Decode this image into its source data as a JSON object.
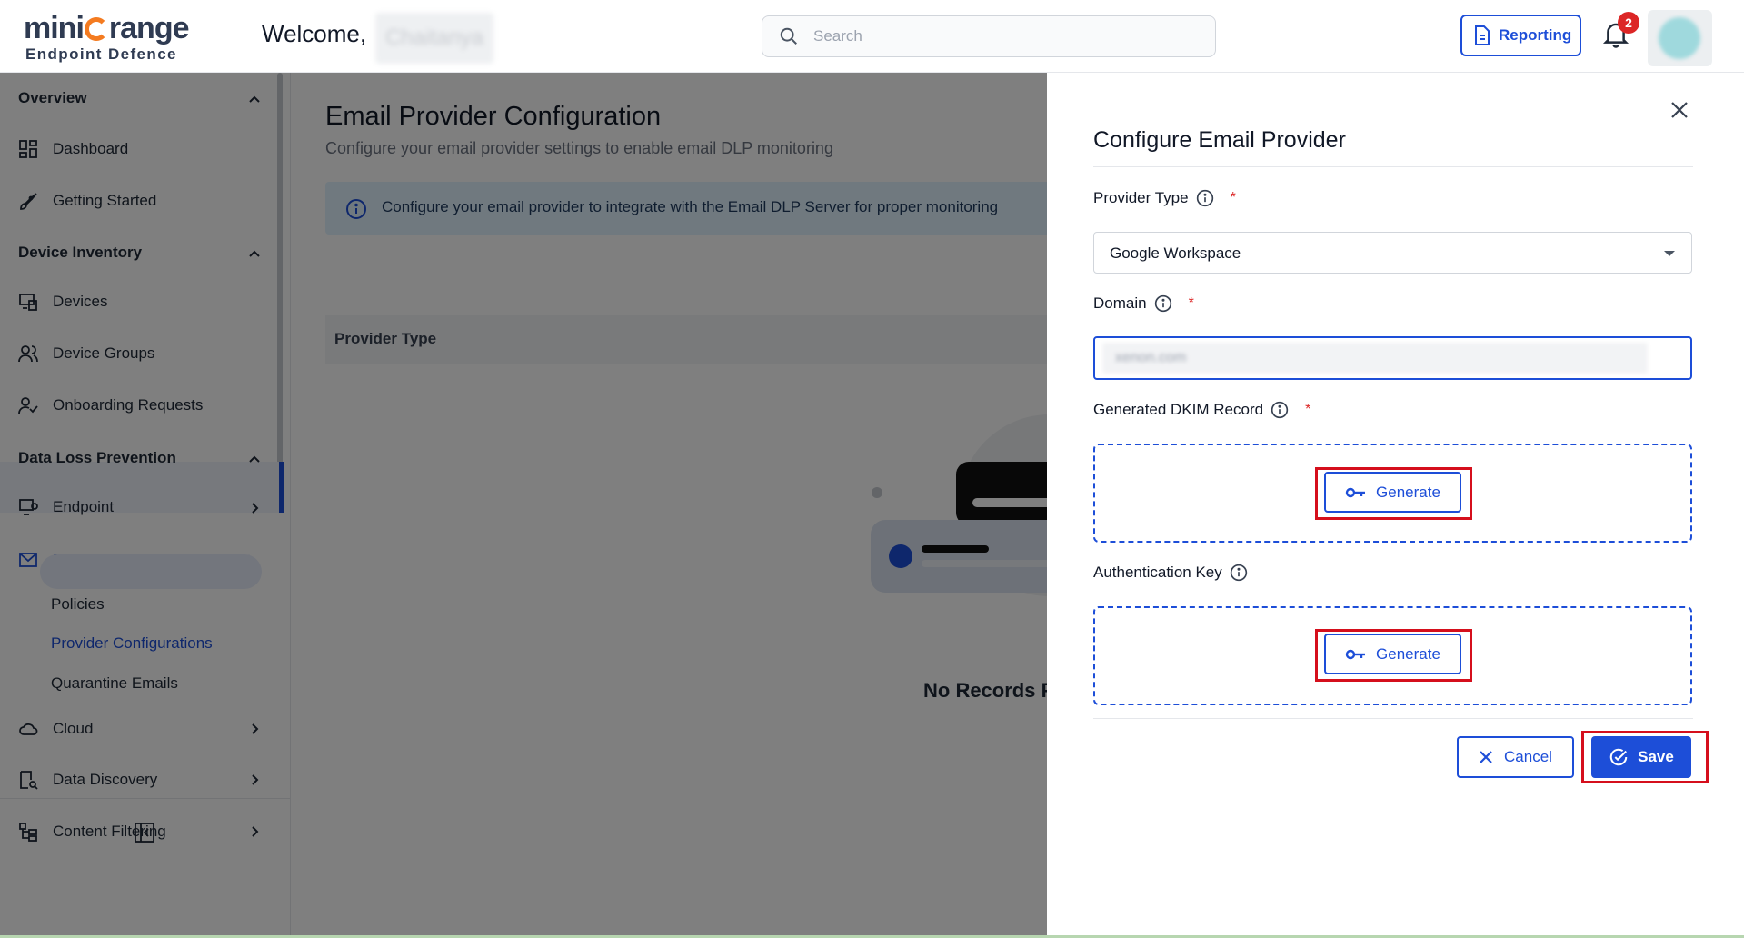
{
  "header": {
    "logo_main": "miniOrange",
    "logo_sub": "Endpoint Defence",
    "welcome": "Welcome,",
    "user_name": "Chaitanya",
    "search_placeholder": "Search",
    "reporting_label": "Reporting",
    "notification_count": "2"
  },
  "sidebar": {
    "sections": {
      "overview": "Overview",
      "device_inventory": "Device Inventory",
      "dlp": "Data Loss Prevention"
    },
    "items": {
      "dashboard": "Dashboard",
      "getting_started": "Getting Started",
      "devices": "Devices",
      "device_groups": "Device Groups",
      "onboarding_requests": "Onboarding Requests",
      "endpoint": "Endpoint",
      "email": "Email",
      "cloud": "Cloud",
      "data_discovery": "Data Discovery",
      "content_filtering": "Content Filtering"
    },
    "email_sub": {
      "policies": "Policies",
      "provider_configurations": "Provider Configurations",
      "quarantine_emails": "Quarantine Emails"
    }
  },
  "main": {
    "title": "Email Provider Configuration",
    "subtitle": "Configure your email provider settings to enable email DLP monitoring",
    "info_text": "Configure your email provider to integrate with the Email DLP Server for proper monitoring",
    "table_header": "Provider Type",
    "empty_text": "No Records Found"
  },
  "drawer": {
    "title": "Configure Email Provider",
    "provider_type_label": "Provider Type",
    "provider_type_value": "Google Workspace",
    "domain_label": "Domain",
    "domain_value": "xenon.com",
    "dkim_label": "Generated DKIM Record",
    "auth_key_label": "Authentication Key",
    "generate_label": "Generate",
    "cancel_label": "Cancel",
    "save_label": "Save"
  },
  "colors": {
    "primary": "#1d4ed8",
    "highlight": "#d50f1c",
    "brand_orange": "#f47b20",
    "required": "#dc2626"
  }
}
